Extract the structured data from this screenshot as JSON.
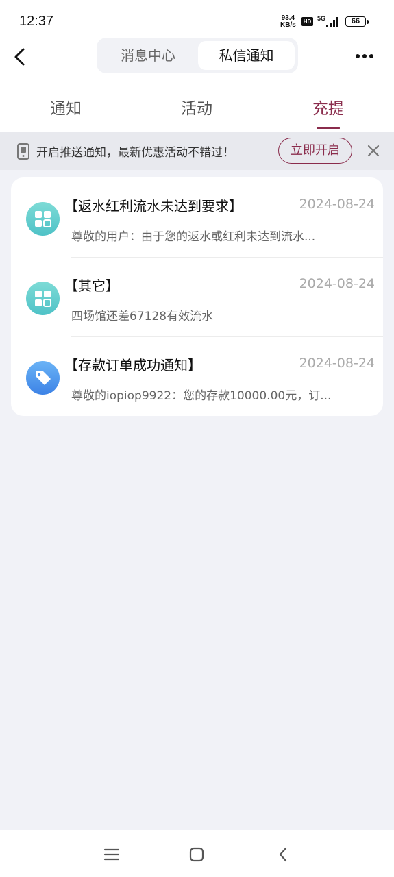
{
  "status_bar": {
    "time": "12:37",
    "net_speed_value": "93.4",
    "net_speed_unit": "KB/s",
    "hd_label": "HD",
    "signal_label": "5G",
    "battery": "66"
  },
  "header": {
    "segments": [
      {
        "label": "消息中心",
        "active": false
      },
      {
        "label": "私信通知",
        "active": true
      }
    ],
    "back_icon": "chevron-left-icon",
    "more_icon": "more-dots-icon"
  },
  "tabs": [
    {
      "label": "通知",
      "active": false
    },
    {
      "label": "活动",
      "active": false
    },
    {
      "label": "充提",
      "active": true
    }
  ],
  "banner": {
    "text": "开启推送通知，最新优惠活动不错过！",
    "button_label": "立即开启",
    "icon": "phone-icon",
    "close_icon": "close-icon"
  },
  "messages": [
    {
      "title": "【返水红利流水未达到要求】",
      "date": "2024-08-24",
      "preview": "尊敬的用户：由于您的返水或红利未达到流水...",
      "icon": "grid-icon"
    },
    {
      "title": "【其它】",
      "date": "2024-08-24",
      "preview": "四场馆还差67128有效流水",
      "icon": "grid-icon"
    },
    {
      "title": "【存款订单成功通知】",
      "date": "2024-08-24",
      "preview": "尊敬的iopiop9922：您的存款10000.00元，订...",
      "icon": "tag-icon"
    }
  ],
  "colors": {
    "accent": "#8a2c4c",
    "page_bg": "#f1f2f7",
    "teal_icon": "#4fc2c7",
    "blue_icon": "#3d83e6"
  }
}
